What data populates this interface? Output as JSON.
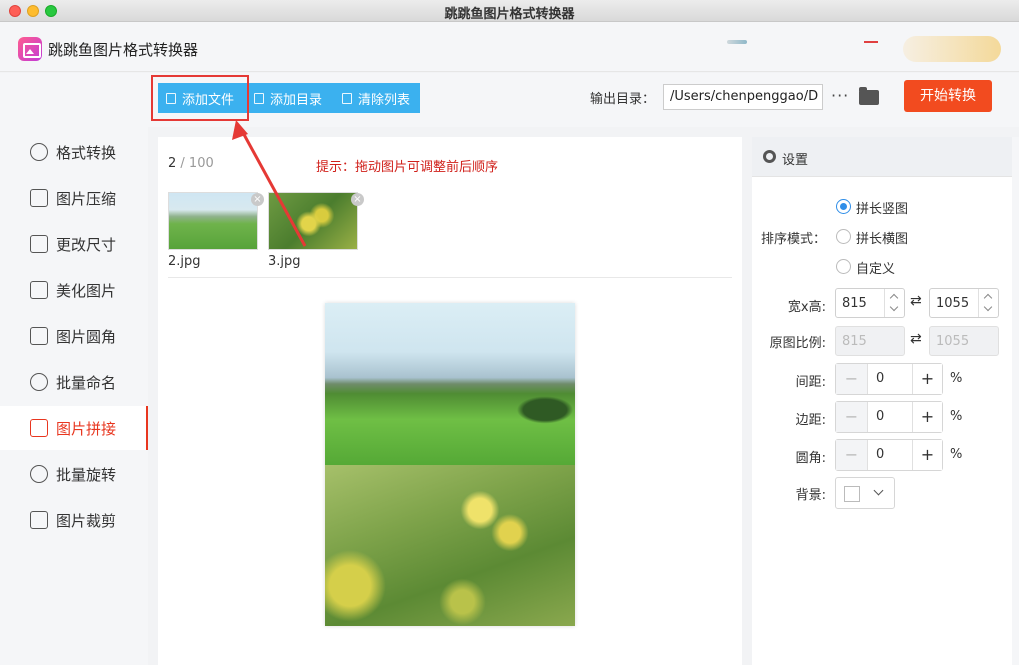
{
  "window": {
    "title": "跳跳鱼图片格式转换器"
  },
  "app": {
    "title": "跳跳鱼图片格式转换器"
  },
  "sidebar": {
    "items": [
      {
        "label": "格式转换",
        "icon": "convert-icon"
      },
      {
        "label": "图片压缩",
        "icon": "compress-icon"
      },
      {
        "label": "更改尺寸",
        "icon": "resize-icon"
      },
      {
        "label": "美化图片",
        "icon": "beautify-icon"
      },
      {
        "label": "图片圆角",
        "icon": "round-corner-icon"
      },
      {
        "label": "批量命名",
        "icon": "rename-icon"
      },
      {
        "label": "图片拼接",
        "icon": "stitch-icon",
        "active": true
      },
      {
        "label": "批量旋转",
        "icon": "rotate-icon"
      },
      {
        "label": "图片裁剪",
        "icon": "crop-icon"
      }
    ]
  },
  "toolbar": {
    "add_file": "添加文件",
    "add_dir": "添加目录",
    "clear_list": "清除列表",
    "output_label": "输出目录：",
    "output_path": "/Users/chenpenggao/D",
    "more": "···",
    "start": "开始转换"
  },
  "main": {
    "count": "2",
    "count_total": " / 100",
    "tip": "提示：拖动图片可调整前后顺序",
    "files": [
      {
        "name": "2.jpg"
      },
      {
        "name": "3.jpg"
      }
    ]
  },
  "settings": {
    "title": "设置",
    "sort_mode_label": "排序模式：",
    "sort_options": [
      "拼长竖图",
      "拼长横图",
      "自定义"
    ],
    "sort_selected": "拼长竖图",
    "size_label": "宽x高:",
    "width": "815",
    "height": "1055",
    "ratio_label": "原图比例:",
    "ratio_w": "815",
    "ratio_h": "1055",
    "spacing_label": "间距:",
    "spacing": "0",
    "margin_label": "边距:",
    "margin": "0",
    "radius_label": "圆角:",
    "radius": "0",
    "bg_label": "背景:",
    "pct": "%",
    "minus": "−",
    "plus": "+"
  },
  "colors": {
    "accent_red": "#f24b1f",
    "button_blue": "#3bb1ef",
    "active_nav": "#e8361f",
    "tip_red": "#d0201a"
  }
}
